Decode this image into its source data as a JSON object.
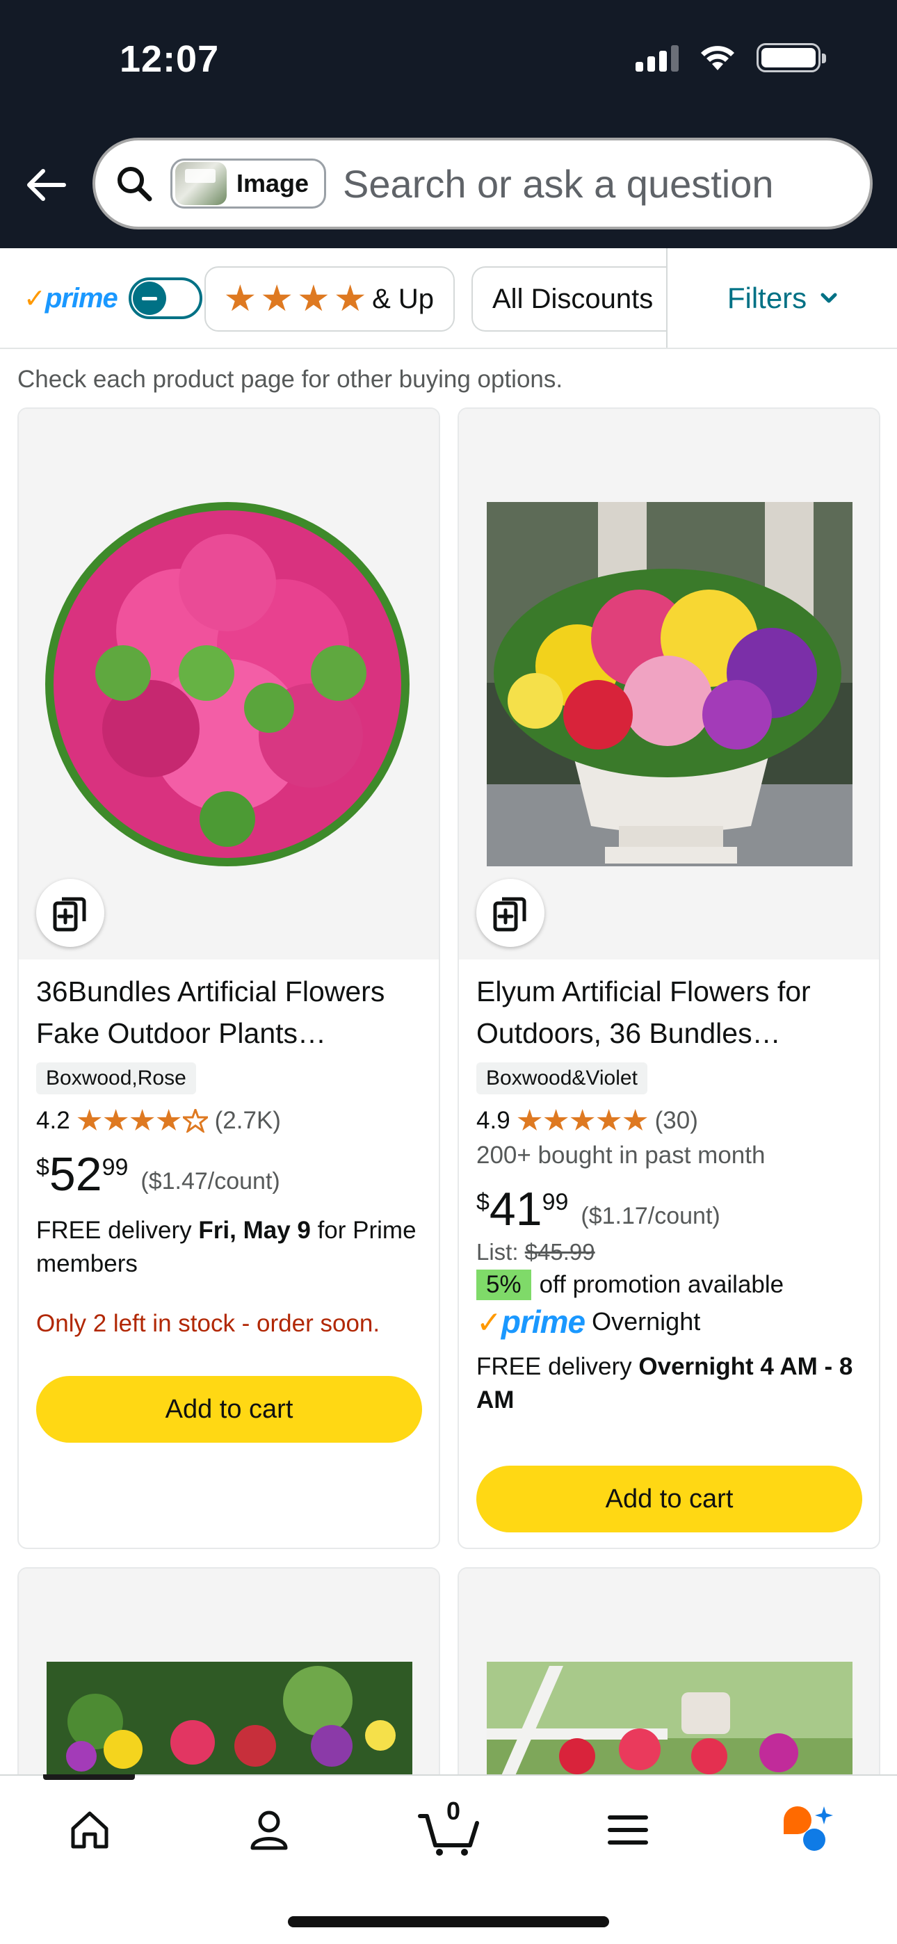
{
  "status_bar": {
    "time": "12:07"
  },
  "search": {
    "image_chip_label": "Image",
    "placeholder": "Search or ask a question"
  },
  "filters": {
    "prime_label": "prime",
    "prime_check": "✓",
    "stars_chip_suffix": "& Up",
    "discounts_chip": "All Discounts",
    "filters_button": "Filters"
  },
  "hint_text": "Check each product page for other buying options.",
  "products": [
    {
      "title_line1": "36Bundles Artificial Flowers",
      "title_line2": "Fake Outdoor Plants…",
      "variant": "Boxwood,Rose",
      "rating": "4.2",
      "rating_value": 4.2,
      "review_count": "(2.7K)",
      "price_symbol": "$",
      "price_whole": "52",
      "price_fraction": "99",
      "unit_price": "($1.47/count)",
      "delivery_prefix": "FREE delivery ",
      "delivery_date": "Fri, May 9",
      "delivery_suffix": " for Prime members",
      "stock_warning": "Only 2 left in stock - order soon.",
      "add_to_cart": "Add to cart"
    },
    {
      "title_line1": "Elyum Artificial Flowers for",
      "title_line2": "Outdoors, 36 Bundles…",
      "variant": "Boxwood&Violet",
      "rating": "4.9",
      "rating_value": 4.9,
      "review_count": "(30)",
      "bought": "200+ bought in past month",
      "price_symbol": "$",
      "price_whole": "41",
      "price_fraction": "99",
      "unit_price": "($1.17/count)",
      "list_label": "List: ",
      "list_price": "$45.99",
      "promo_badge": "5%",
      "promo_text": "off promotion available",
      "prime_logo": "prime",
      "prime_check": "✓",
      "prime_speed": "Overnight",
      "delivery_prefix": "FREE delivery ",
      "delivery_date": "Overnight 4 AM - 8 AM",
      "add_to_cart": "Add to cart"
    }
  ],
  "bottom_nav": {
    "cart_count": "0"
  },
  "colors": {
    "header_bg": "#131a26",
    "prime_blue": "#1a98ff",
    "star_orange": "#de7921",
    "add_to_cart_yellow": "#ffd814",
    "stock_red": "#b12704",
    "teal_link": "#007185",
    "promo_green": "#7fda69"
  },
  "icons": [
    "back-arrow-icon",
    "search-icon",
    "compare-icon",
    "chevron-down-icon",
    "home-icon",
    "account-icon",
    "cart-icon",
    "menu-icon",
    "rufus-icon"
  ]
}
